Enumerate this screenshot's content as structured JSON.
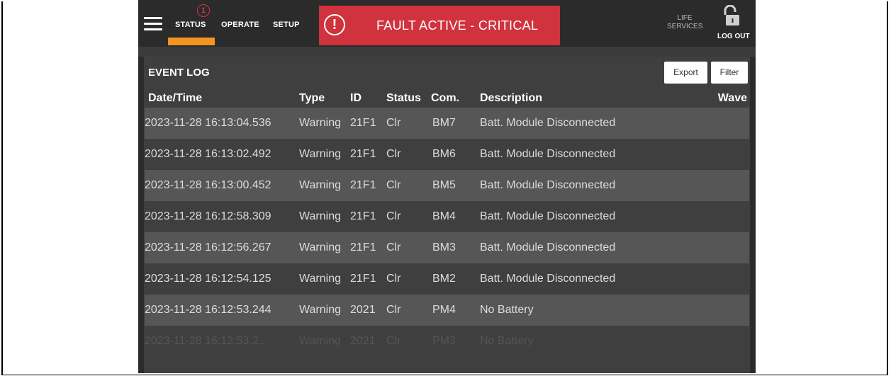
{
  "header": {
    "nav_tabs": [
      {
        "label": "STATUS",
        "active": true
      },
      {
        "label": "OPERATE",
        "active": false
      },
      {
        "label": "SETUP",
        "active": false
      }
    ],
    "notification_count": "1",
    "alarm": {
      "icon": "!",
      "text": "FAULT ACTIVE - CRITICAL"
    },
    "life_services": "LIFE SERVICES",
    "logout_label": "LOG OUT"
  },
  "event_log": {
    "title": "EVENT LOG",
    "export_label": "Export",
    "filter_label": "Filter",
    "columns": [
      "Date/Time",
      "Type",
      "ID",
      "Status",
      "Com.",
      "Description",
      "Wave"
    ],
    "rows": [
      {
        "datetime": "2023-11-28 16:13:04.536",
        "type": "Warning",
        "id": "21F1",
        "status": "Clr",
        "com": "BM7",
        "description": "Batt. Module Disconnected"
      },
      {
        "datetime": "2023-11-28 16:13:02.492",
        "type": "Warning",
        "id": "21F1",
        "status": "Clr",
        "com": "BM6",
        "description": "Batt. Module Disconnected"
      },
      {
        "datetime": "2023-11-28 16:13:00.452",
        "type": "Warning",
        "id": "21F1",
        "status": "Clr",
        "com": "BM5",
        "description": "Batt. Module Disconnected"
      },
      {
        "datetime": "2023-11-28 16:12:58.309",
        "type": "Warning",
        "id": "21F1",
        "status": "Clr",
        "com": "BM4",
        "description": "Batt. Module Disconnected"
      },
      {
        "datetime": "2023-11-28 16:12:56.267",
        "type": "Warning",
        "id": "21F1",
        "status": "Clr",
        "com": "BM3",
        "description": "Batt. Module Disconnected"
      },
      {
        "datetime": "2023-11-28 16:12:54.125",
        "type": "Warning",
        "id": "21F1",
        "status": "Clr",
        "com": "BM2",
        "description": "Batt. Module Disconnected"
      },
      {
        "datetime": "2023-11-28 16:12:53.244",
        "type": "Warning",
        "id": "2021",
        "status": "Clr",
        "com": "PM4",
        "description": "No Battery"
      },
      {
        "datetime": "2023-11-28 16:12:53.2..",
        "type": "Warning",
        "id": "2021",
        "status": "Clr",
        "com": "PM3",
        "description": "No Battery"
      }
    ]
  },
  "icons": {
    "menu": "hamburger-menu-icon",
    "alarm": "exclamation-circle-icon",
    "lock": "unlocked-padlock-icon"
  },
  "colors": {
    "accent_orange": "#f39321",
    "alarm_red": "#d0323e",
    "background": "#2b2b2b",
    "panel": "#3f3f3f",
    "row_stripe": "#565656"
  }
}
